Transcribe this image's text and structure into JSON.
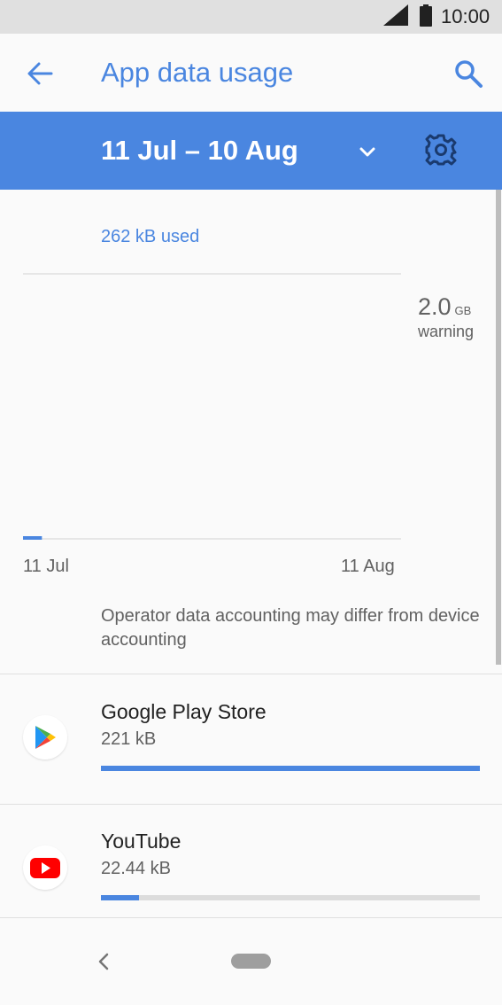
{
  "status_bar": {
    "time": "10:00",
    "icons": [
      "signal-icon",
      "battery-icon"
    ]
  },
  "app_bar": {
    "title": "App data usage",
    "icons": [
      "back-arrow-icon",
      "search-icon"
    ]
  },
  "cycle_bar": {
    "label": "11 Jul – 10 Aug",
    "icons": [
      "chevron-down-icon",
      "gear-icon"
    ]
  },
  "usage": {
    "total_text": "262 kB used",
    "warning_value": "2.0",
    "warning_unit": "GB",
    "warning_label": "warning",
    "note": "Operator data accounting may differ from device accounting"
  },
  "chart_data": {
    "type": "area",
    "x_labels": [
      "11 Jul",
      "11 Aug"
    ],
    "used_kb": 262,
    "warning_gb": 2.0,
    "usage_fraction_of_period": 0.05
  },
  "apps": [
    {
      "name": "Google Play Store",
      "usage": "221 kB",
      "share": 1.0,
      "icon": "play-store-icon"
    },
    {
      "name": "YouTube",
      "usage": "22.44 kB",
      "share": 0.1,
      "icon": "youtube-icon"
    }
  ],
  "nav_bar": {
    "icons": [
      "nav-back-icon",
      "nav-home-icon"
    ]
  },
  "colors": {
    "accent": "#4a86e0",
    "status_bar_bg": "#e0e0e0",
    "background": "#fafafa"
  }
}
